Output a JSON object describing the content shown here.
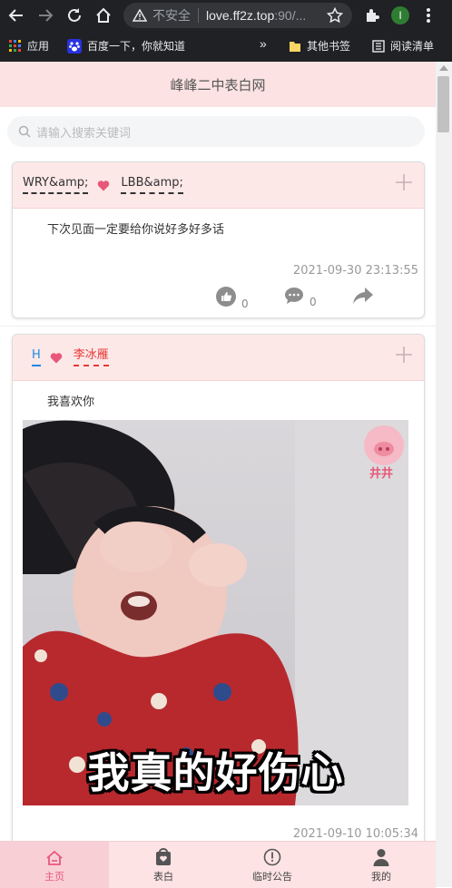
{
  "browser": {
    "insecure_label": "不安全",
    "url_host": "love.ff2z.top",
    "url_rest": ":90/...",
    "profile_initial": "I",
    "bookmarks": {
      "apps": "应用",
      "baidu": "百度一下，你就知道",
      "more": "»",
      "other": "其他书签",
      "reading": "阅读清单"
    }
  },
  "page": {
    "title": "峰峰二中表白网",
    "search_placeholder": "请输入搜索关键词"
  },
  "posts": [
    {
      "from": "WRY&amp;",
      "to": "LBB&amp;",
      "message": "下次见面一定要给你说好多好多话",
      "time": "2021-09-30 23:13:55",
      "likes": "0",
      "comments": "0"
    },
    {
      "from": "H",
      "to": "李冰雁",
      "message": "我喜欢你",
      "image_caption": "我真的好伤心",
      "sticker_text": "井井",
      "time": "2021-09-10 10:05:34"
    }
  ],
  "tabs": [
    {
      "label": "主页",
      "icon": "home-icon"
    },
    {
      "label": "表白",
      "icon": "bag-heart-icon"
    },
    {
      "label": "临时公告",
      "icon": "exclamation-circle-icon"
    },
    {
      "label": "我的",
      "icon": "user-icon"
    }
  ],
  "colors": {
    "accent_pink": "#e8577a",
    "header_bg": "#fce2e2",
    "tab_active_bg": "#f9cfd6",
    "name_blue": "#1e88e5",
    "name_red": "#e53935"
  }
}
